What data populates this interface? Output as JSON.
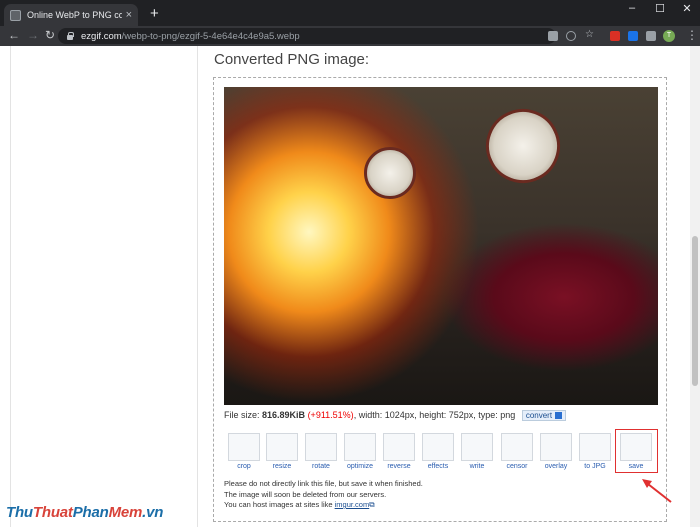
{
  "browser": {
    "tab_title": "Online WebP to PNG converter",
    "tab_close": "×",
    "new_tab": "+",
    "window_controls": [
      "–",
      "☐",
      "✕"
    ],
    "nav": {
      "back": "←",
      "forward": "→",
      "reload": "↻"
    },
    "url_host": "ezgif.com",
    "url_path": "/webp-to-png/ezgif-5-4e64e4c4e9a5.webp",
    "profile_initial": "T",
    "menu": "⋮"
  },
  "page": {
    "heading": "Converted PNG image:",
    "file_info": {
      "prefix": "File size: ",
      "size": "816.89KiB",
      "change": "(+911.51%)",
      "details": ", width: 1024px, height: 752px, type: png",
      "convert_label": "convert"
    },
    "tools": [
      {
        "label": "crop",
        "icon": "crop-icon"
      },
      {
        "label": "resize",
        "icon": "resize-icon"
      },
      {
        "label": "rotate",
        "icon": "rotate-icon"
      },
      {
        "label": "optimize",
        "icon": "optimize-icon"
      },
      {
        "label": "reverse",
        "icon": "reverse-icon"
      },
      {
        "label": "effects",
        "icon": "effects-icon"
      },
      {
        "label": "write",
        "icon": "write-icon"
      },
      {
        "label": "censor",
        "icon": "censor-icon"
      },
      {
        "label": "overlay",
        "icon": "overlay-icon"
      },
      {
        "label": "to JPG",
        "icon": "to-jpg-icon"
      },
      {
        "label": "save",
        "icon": "save-icon"
      }
    ],
    "notes": {
      "line1": "Please do not directly link this file, but save it when finished.",
      "line2": "The image will soon be deleted from our servers.",
      "line3_prefix": "You can host images at sites like ",
      "line3_link": "imgur.com"
    }
  },
  "watermark": {
    "parts": [
      "Thu",
      "Thuat",
      "Phan",
      "Mem",
      ".vn"
    ],
    "colors": [
      "#1b6ea8",
      "#d8433a",
      "#1b6ea8",
      "#d8433a",
      "#1b6ea8"
    ]
  },
  "colors": {
    "tab_bar": "#202124",
    "toolbar": "#35363a",
    "link": "#1a4d8f",
    "highlight": "#e03030"
  }
}
